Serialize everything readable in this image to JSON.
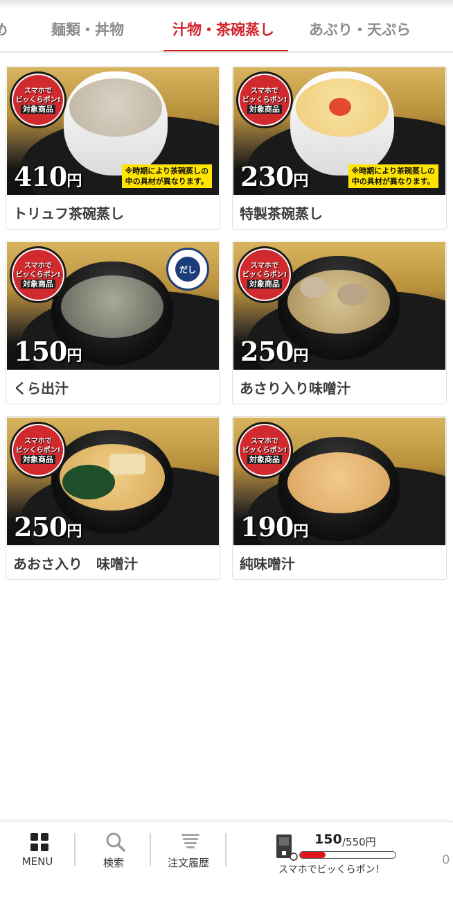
{
  "tabs": [
    {
      "label": "め",
      "active": false
    },
    {
      "label": "麺類・丼物",
      "active": false
    },
    {
      "label": "汁物・茶碗蒸し",
      "active": true
    },
    {
      "label": "あぶり・天ぷら",
      "active": false
    }
  ],
  "badge": {
    "line1": "スマホで",
    "line2": "ビッくらポン!",
    "line3": "対象商品"
  },
  "kura_dashi_logo": "だし",
  "price_unit": "円",
  "products": [
    {
      "name": "トリュフ茶碗蒸し",
      "price": "410",
      "note_line1": "※時期により茶碗蒸しの",
      "note_line2": "中の具材が異なります。"
    },
    {
      "name": "特製茶碗蒸し",
      "price": "230",
      "note_line1": "※時期により茶碗蒸しの",
      "note_line2": "中の具材が異なります。"
    },
    {
      "name": "くら出汁",
      "price": "150"
    },
    {
      "name": "あさり入り味噌汁",
      "price": "250"
    },
    {
      "name": "あおさ入り　味噌汁",
      "price": "250"
    },
    {
      "name": "純味噌汁",
      "price": "190"
    }
  ],
  "bottom_nav": {
    "menu_label": "MENU",
    "search_label": "検索",
    "history_label": "注文履歴"
  },
  "bikkura": {
    "current": "150",
    "total": "/550円",
    "progress": 0.27,
    "label": "スマホでビッくらポン！"
  },
  "cart_count": "0",
  "colors": {
    "accent": "#d2232a",
    "progress": "#e0141c",
    "note_bg": "#ffe400"
  }
}
